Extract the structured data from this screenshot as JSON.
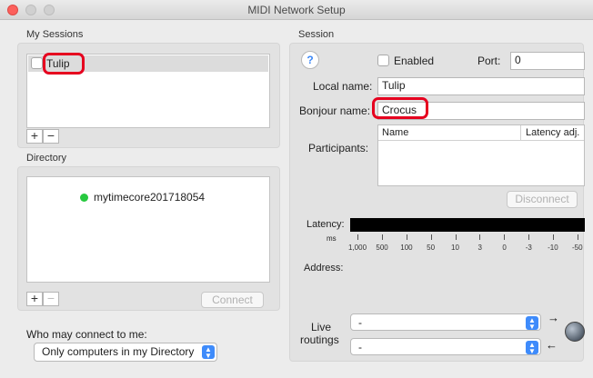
{
  "window": {
    "title": "MIDI Network Setup"
  },
  "left": {
    "sessions_label": "My Sessions",
    "sessions": [
      {
        "name": "Tulip",
        "enabled": false
      }
    ],
    "add_symbol": "+",
    "remove_symbol": "−",
    "directory_label": "Directory",
    "directory_items": [
      {
        "name": "mytimecore201718054",
        "status_color": "#27c93f"
      }
    ],
    "connect_label": "Connect",
    "who_label": "Who may connect to me:",
    "who_value": "Only computers in my Directory"
  },
  "session": {
    "label": "Session",
    "help_symbol": "?",
    "enabled_label": "Enabled",
    "enabled": false,
    "port_label": "Port:",
    "port_value": "0",
    "local_name_label": "Local name:",
    "local_name_value": "Tulip",
    "bonjour_label": "Bonjour name:",
    "bonjour_value": "Crocus",
    "participants_label": "Participants:",
    "participants_columns": [
      "Name",
      "Latency adj."
    ],
    "disconnect_label": "Disconnect",
    "latency_label": "Latency:",
    "latency_unit": "ms",
    "latency_ticks": [
      "1,000",
      "500",
      "100",
      "50",
      "10",
      "3",
      "0",
      "-3",
      "-10",
      "-50"
    ],
    "address_label": "Address:",
    "live_label": "Live",
    "routings_label": "routings",
    "routing_in": "-",
    "routing_out": "-"
  },
  "colors": {
    "accent": "#3e8bfb",
    "highlight_ring": "#e6001f"
  }
}
